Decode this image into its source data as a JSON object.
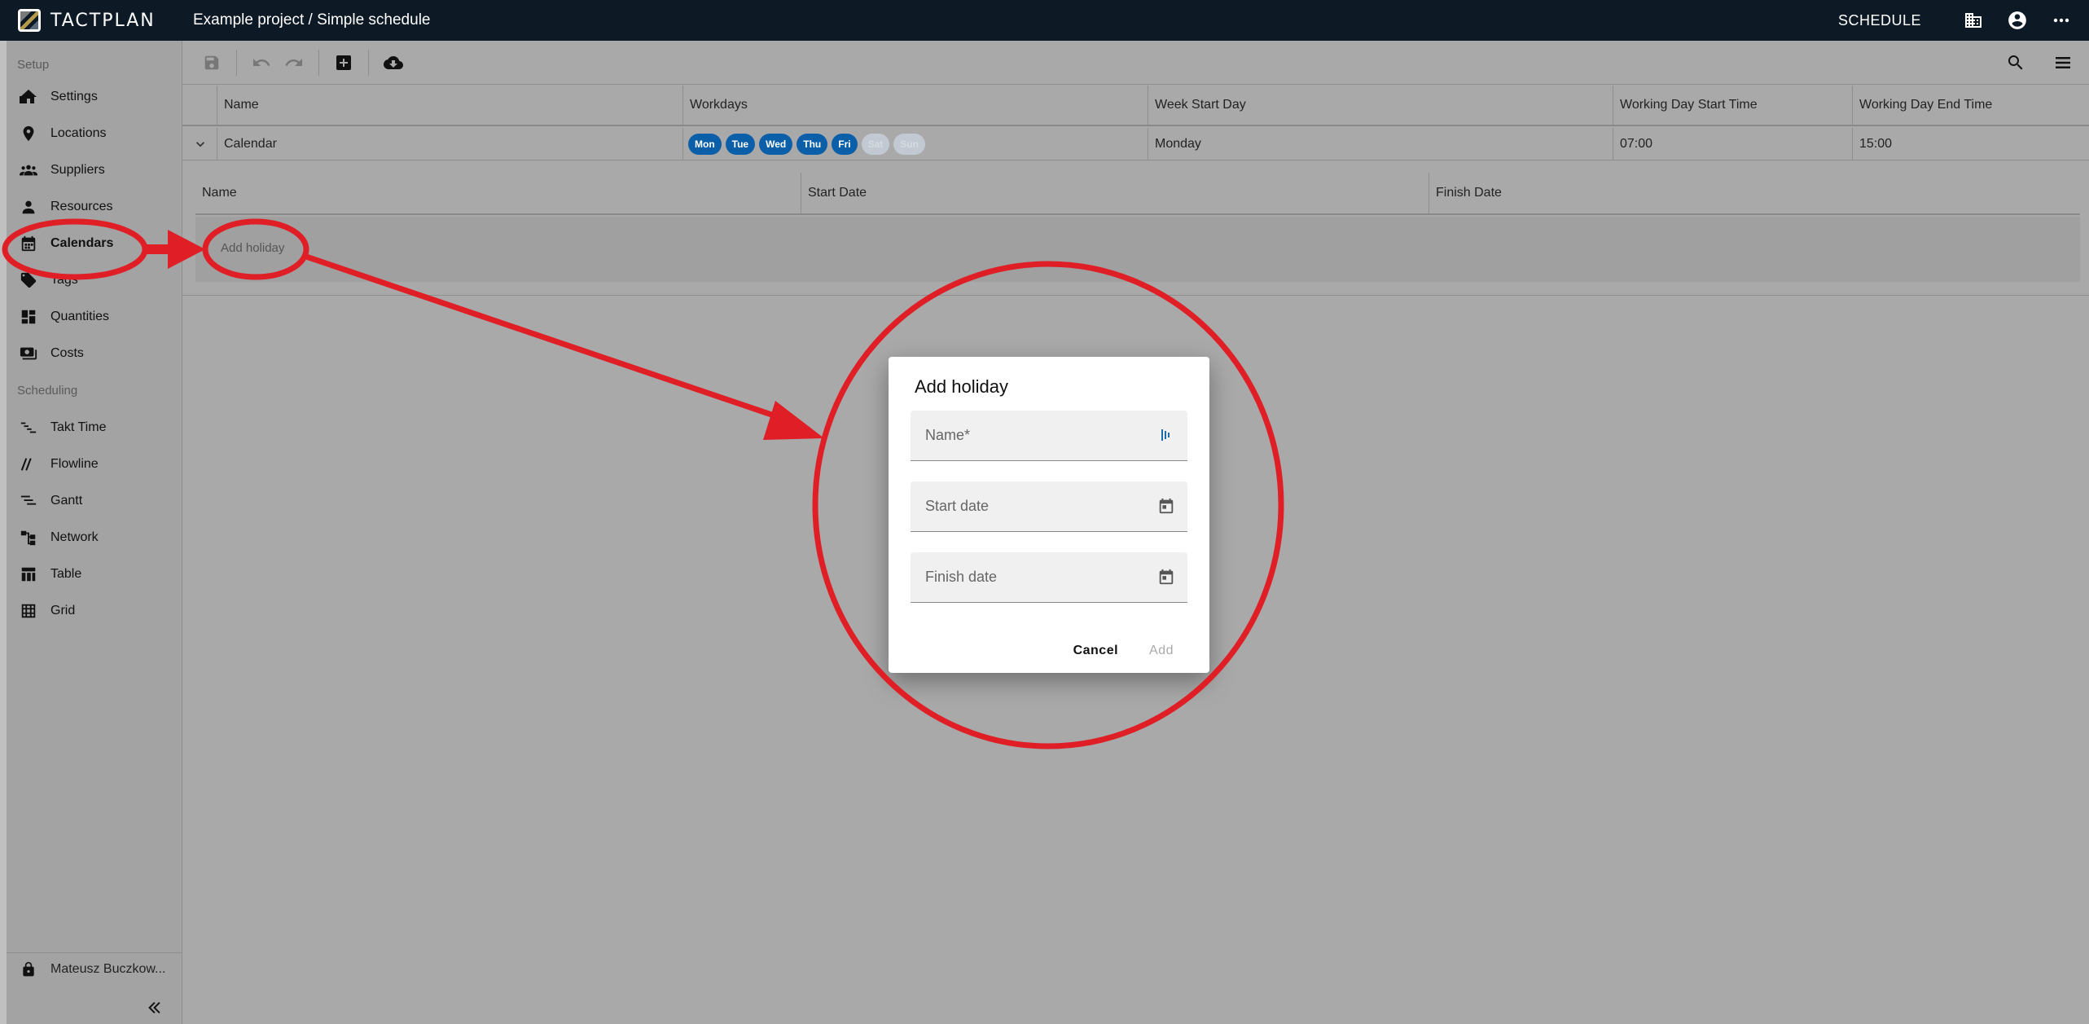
{
  "app": {
    "logo_text": "TACTPLAN",
    "project_title": "Example project / Simple schedule",
    "mode_label": "SCHEDULE"
  },
  "toolbar": {
    "icons": [
      "save-icon",
      "undo-icon",
      "redo-icon",
      "add-box-icon",
      "cloud-download-icon",
      "search-icon",
      "menu-icon"
    ]
  },
  "sidebar": {
    "setup_label": "Setup",
    "setup_items": [
      {
        "label": "Settings",
        "icon": "home-icon"
      },
      {
        "label": "Locations",
        "icon": "location-pin-icon"
      },
      {
        "label": "Suppliers",
        "icon": "group-icon"
      },
      {
        "label": "Resources",
        "icon": "person-icon"
      },
      {
        "label": "Calendars",
        "icon": "calendar-icon"
      },
      {
        "label": "Tags",
        "icon": "tag-icon"
      },
      {
        "label": "Quantities",
        "icon": "dashboard-icon"
      },
      {
        "label": "Costs",
        "icon": "money-icon"
      }
    ],
    "scheduling_label": "Scheduling",
    "scheduling_items": [
      {
        "label": "Takt Time",
        "icon": "takt-icon"
      },
      {
        "label": "Flowline",
        "icon": "flowline-icon"
      },
      {
        "label": "Gantt",
        "icon": "gantt-icon"
      },
      {
        "label": "Network",
        "icon": "network-icon"
      },
      {
        "label": "Table",
        "icon": "table-icon"
      },
      {
        "label": "Grid",
        "icon": "grid-icon"
      }
    ],
    "user_name": "Mateusz Buczkow..."
  },
  "calendar_table": {
    "headers": {
      "name": "Name",
      "workdays": "Workdays",
      "week_start": "Week Start Day",
      "start_time": "Working Day Start Time",
      "end_time": "Working Day End Time"
    },
    "row": {
      "name": "Calendar",
      "workdays": [
        {
          "label": "Mon",
          "active": true
        },
        {
          "label": "Tue",
          "active": true
        },
        {
          "label": "Wed",
          "active": true
        },
        {
          "label": "Thu",
          "active": true
        },
        {
          "label": "Fri",
          "active": true
        },
        {
          "label": "Sat",
          "active": false
        },
        {
          "label": "Sun",
          "active": false
        }
      ],
      "week_start": "Monday",
      "start_time": "07:00",
      "end_time": "15:00"
    }
  },
  "holiday_table": {
    "headers": {
      "name": "Name",
      "start_date": "Start Date",
      "finish_date": "Finish Date"
    },
    "add_link": "Add holiday"
  },
  "dialog": {
    "title": "Add holiday",
    "name_placeholder": "Name*",
    "start_placeholder": "Start date",
    "finish_placeholder": "Finish date",
    "cancel_label": "Cancel",
    "add_label": "Add"
  },
  "annotation_color": "#e01e25"
}
